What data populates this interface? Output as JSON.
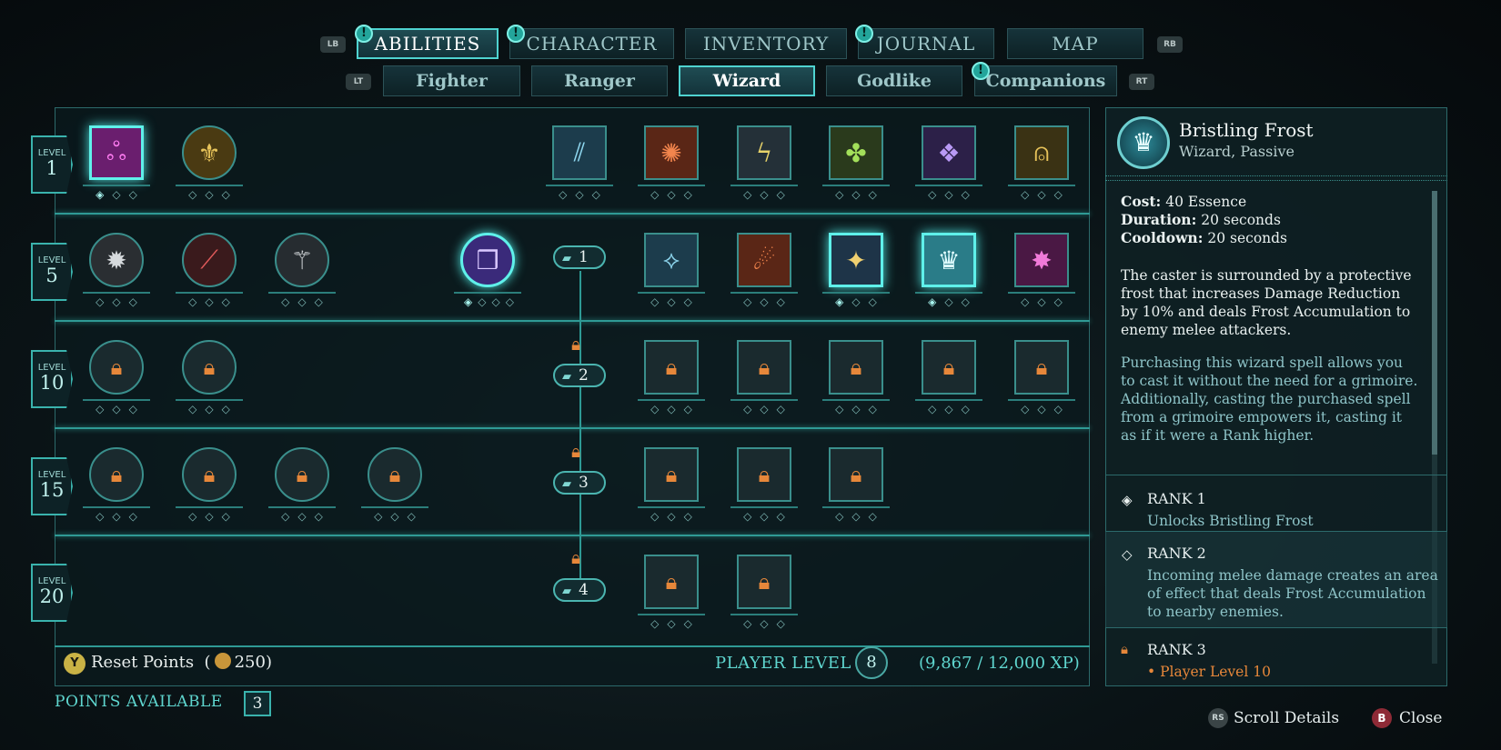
{
  "top_nav": {
    "left_hint": "LB",
    "right_hint": "RB",
    "tabs": [
      "ABILITIES",
      "CHARACTER",
      "INVENTORY",
      "JOURNAL",
      "MAP"
    ],
    "notif_mark": "!"
  },
  "sub_nav": {
    "left_hint": "LT",
    "right_hint": "RT",
    "tabs": [
      "Fighter",
      "Ranger",
      "Wizard",
      "Godlike",
      "Companions"
    ]
  },
  "levels": {
    "label": "LEVEL",
    "values": [
      "1",
      "5",
      "10",
      "15",
      "20"
    ]
  },
  "grimoire_ranks": [
    "1",
    "2",
    "3",
    "4"
  ],
  "pips": "◇◇◇",
  "pips4": "◇◇◇◇",
  "pip_filled": "◈",
  "bottom": {
    "reset_button": "Y",
    "reset_label": "Reset Points",
    "reset_cost": "250",
    "open_paren": "(",
    "close_paren": ")",
    "player_level_label": "PLAYER LEVEL",
    "player_level": "8",
    "xp": "(9,867 / 12,000 XP)",
    "points_label": "POINTS AVAILABLE",
    "points_value": "3"
  },
  "details": {
    "title": "Bristling Frost",
    "subtitle": "Wizard, Passive",
    "cost_label": "Cost:",
    "cost_value": "40 Essence",
    "duration_label": "Duration:",
    "duration_value": "20 seconds",
    "cooldown_label": "Cooldown:",
    "cooldown_value": "20 seconds",
    "description": "The caster is surrounded by a protective frost that increases Damage Reduction by 10% and deals Frost Accumulation to enemy melee attackers.",
    "grimoire_note": "Purchasing this wizard spell allows you to cast it without the need for a grimoire. Additionally, casting the purchased spell from a grimoire empowers it, casting it as if it were a Rank higher.",
    "ranks": [
      {
        "title": "RANK 1",
        "desc": "Unlocks Bristling Frost"
      },
      {
        "title": "RANK 2",
        "desc": "Incoming melee damage creates an area of effect that deals Frost Accumulation to nearby enemies."
      },
      {
        "title": "RANK 3",
        "desc": "• Player Level 10"
      }
    ]
  },
  "footer": {
    "scroll_button": "RS",
    "scroll_label": "Scroll Details",
    "close_button": "B",
    "close_label": "Close"
  },
  "colors": {
    "accent": "#4fd3d0",
    "lock": "#e6873a",
    "panel_bg": "#0d2226"
  }
}
